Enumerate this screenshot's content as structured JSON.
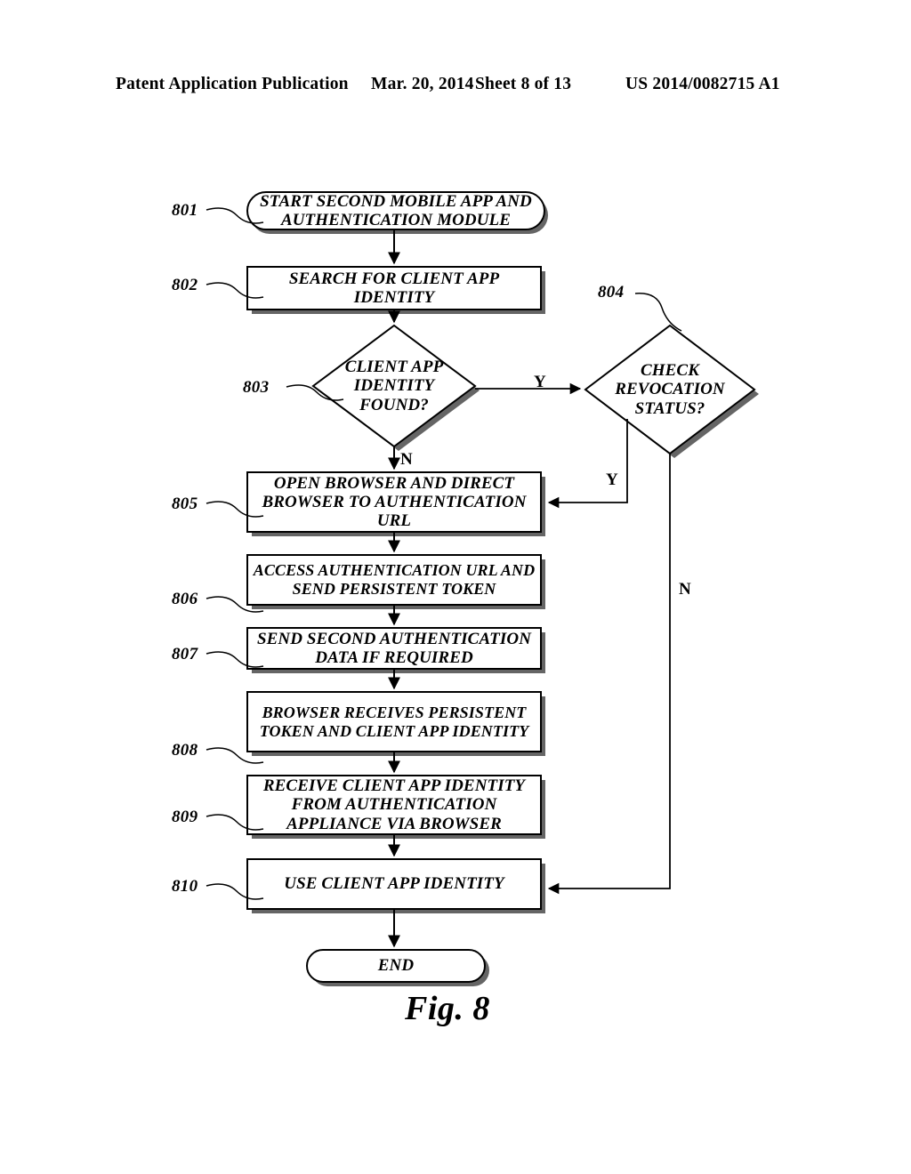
{
  "header": {
    "publication": "Patent Application Publication",
    "date": "Mar. 20, 2014",
    "sheet": "Sheet 8 of 13",
    "patent_number": "US 2014/0082715 A1"
  },
  "figure": {
    "caption": "Fig. 8",
    "ink_color": "#000000",
    "background_color": "#ffffff"
  },
  "nodes": {
    "n801": {
      "ref": "801",
      "label": "START SECOND MOBILE APP AND\nAUTHENTICATION MODULE",
      "shape": "terminator"
    },
    "n802": {
      "ref": "802",
      "label": "SEARCH FOR CLIENT APP IDENTITY",
      "shape": "process"
    },
    "n803": {
      "ref": "803",
      "label": "CLIENT APP\nIDENTITY\nFOUND?",
      "shape": "decision"
    },
    "n804": {
      "ref": "804",
      "label": "CHECK\nREVOCATION\nSTATUS?",
      "shape": "decision"
    },
    "n805": {
      "ref": "805",
      "label": "OPEN BROWSER AND DIRECT\nBROWSER TO AUTHENTICATION\nURL",
      "shape": "process"
    },
    "n806": {
      "ref": "806",
      "label": "ACCESS AUTHENTICATION URL AND\nSEND PERSISTENT TOKEN",
      "shape": "process"
    },
    "n807": {
      "ref": "807",
      "label": "SEND SECOND AUTHENTICATION\nDATA IF REQUIRED",
      "shape": "process"
    },
    "n808": {
      "ref": "808",
      "label": "BROWSER RECEIVES PERSISTENT\nTOKEN AND CLIENT APP IDENTITY",
      "shape": "process"
    },
    "n809": {
      "ref": "809",
      "label": "RECEIVE CLIENT APP IDENTITY\nFROM AUTHENTICATION\nAPPLIANCE VIA BROWSER",
      "shape": "process"
    },
    "n810": {
      "ref": "810",
      "label": "USE CLIENT APP IDENTITY",
      "shape": "process"
    },
    "nend": {
      "ref": "",
      "label": "END",
      "shape": "terminator"
    }
  },
  "branches": {
    "b803_yes": "Y",
    "b803_no": "N",
    "b804_yes": "Y",
    "b804_no": "N"
  }
}
